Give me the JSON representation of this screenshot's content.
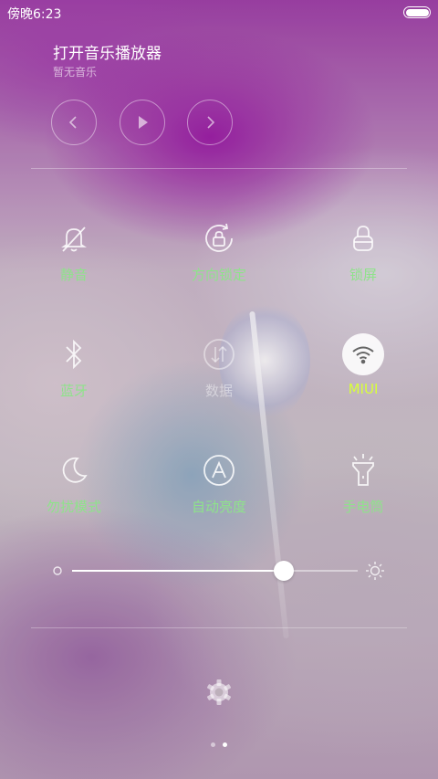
{
  "status_bar": {
    "time": "傍晚6:23"
  },
  "music": {
    "title": "打开音乐播放器",
    "subtitle": "暂无音乐",
    "controls": [
      "previous-icon",
      "play-icon",
      "next-icon"
    ]
  },
  "toggles": [
    {
      "label": "静音",
      "icon": "bell-off-icon",
      "state": "on"
    },
    {
      "label": "方向锁定",
      "icon": "rotation-lock-icon",
      "state": "on"
    },
    {
      "label": "锁屏",
      "icon": "lock-icon",
      "state": "on"
    },
    {
      "label": "蓝牙",
      "icon": "bluetooth-icon",
      "state": "on"
    },
    {
      "label": "数据",
      "icon": "mobile-data-icon",
      "state": "disabled"
    },
    {
      "label": "MIUI",
      "icon": "wifi-icon",
      "state": "active"
    },
    {
      "label": "勿扰模式",
      "icon": "moon-icon",
      "state": "on"
    },
    {
      "label": "自动亮度",
      "icon": "auto-brightness-icon",
      "state": "on"
    },
    {
      "label": "手电筒",
      "icon": "flashlight-icon",
      "state": "on"
    }
  ],
  "brightness": {
    "level": 0.74,
    "min_icon": "brightness-low-icon",
    "max_icon": "brightness-high-icon"
  },
  "footer": {
    "settings_icon": "gear-icon",
    "page_count": 2,
    "current_page": 2
  },
  "colors": {
    "label_green": "#8ee38a",
    "label_lime": "#d8ff3a",
    "dim_label": "rgba(255,255,255,0.45)"
  }
}
